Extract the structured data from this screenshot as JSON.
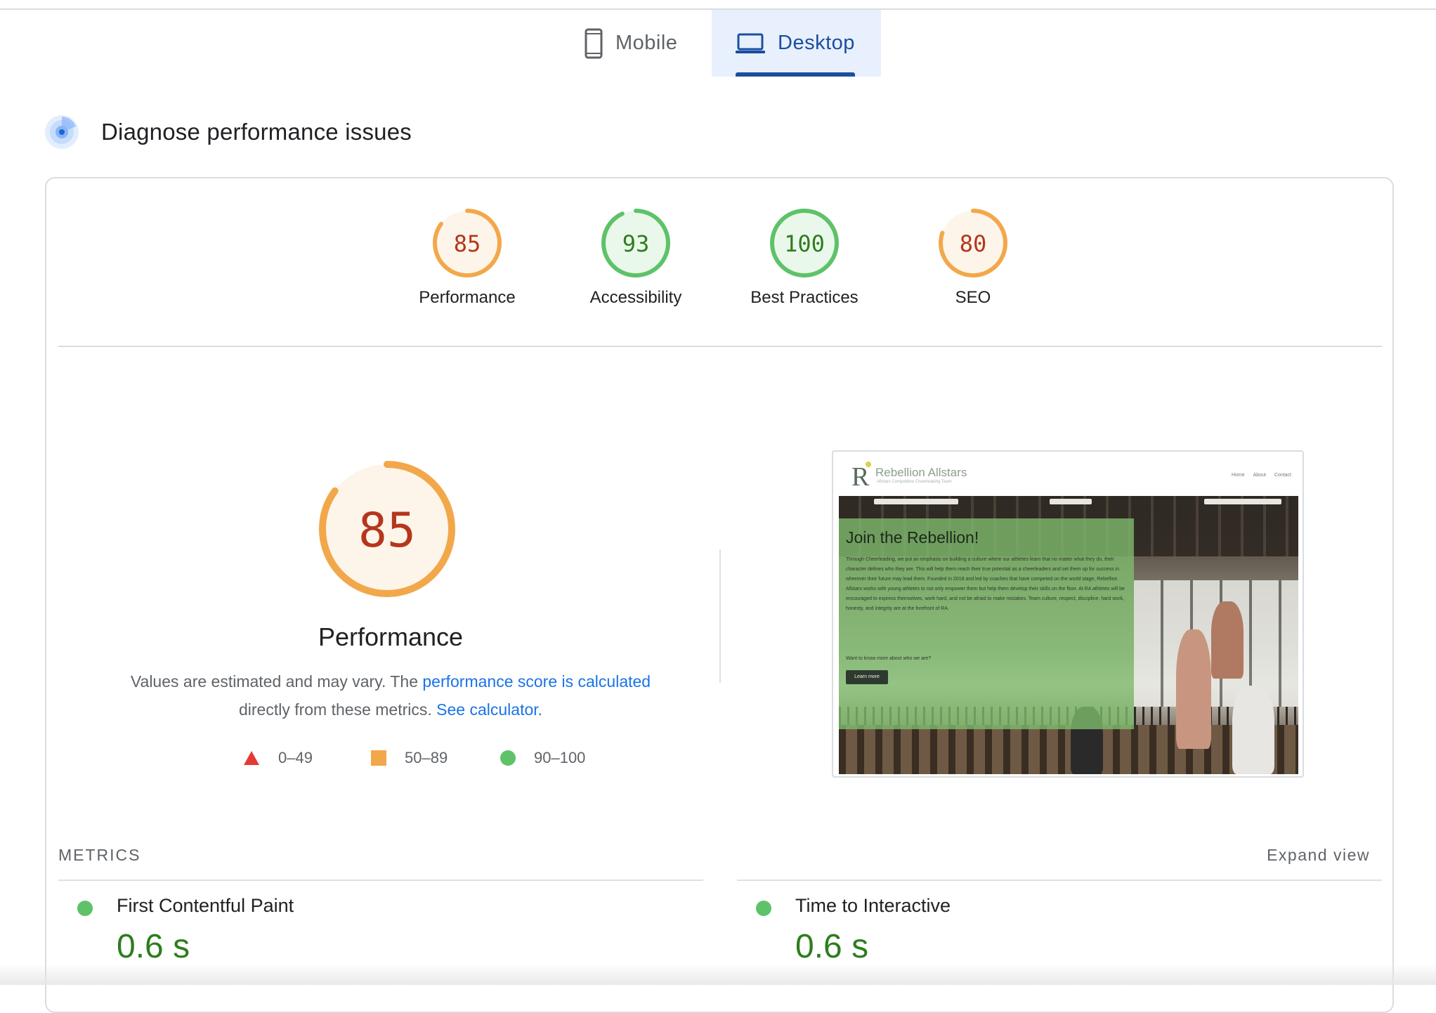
{
  "tabs": [
    {
      "label": "Mobile",
      "icon": "smartphone-icon",
      "selected": false
    },
    {
      "label": "Desktop",
      "icon": "laptop-icon",
      "selected": true
    }
  ],
  "section": {
    "title": "Diagnose performance issues",
    "icon": "radar-icon"
  },
  "scores": [
    {
      "label": "Performance",
      "value": "85",
      "status": "average"
    },
    {
      "label": "Accessibility",
      "value": "93",
      "status": "pass"
    },
    {
      "label": "Best Practices",
      "value": "100",
      "status": "pass"
    },
    {
      "label": "SEO",
      "value": "80",
      "status": "average"
    }
  ],
  "performance": {
    "score": "85",
    "title": "Performance",
    "desc_prefix": "Values are estimated and may vary. The ",
    "desc_link1": "performance score is calculated",
    "desc_middle": " directly from these metrics. ",
    "desc_link2": "See calculator."
  },
  "legend": [
    {
      "range": "0–49",
      "shape": "triangle",
      "color": "#e53935"
    },
    {
      "range": "50–89",
      "shape": "square",
      "color": "#f2a84a"
    },
    {
      "range": "90–100",
      "shape": "circle",
      "color": "#5ec269"
    }
  ],
  "screenshot": {
    "logo_letter": "R",
    "brand": "Rebellion Allstars",
    "tagline": "Allstars Competitive Cheerleading Team",
    "nav": [
      "Home",
      "About",
      "Contact"
    ],
    "heading": "Join the Rebellion!",
    "body": "Through Cheerleading, we put an emphasis on building a culture where our athletes learn that no matter what they do, their character defines who they are. This will help them reach their true potential as a cheerleaders and set them up for success in wherever their future may lead them. Founded in 2018 and led by coaches that have competed on the world stage, Rebellion Allstars works with young athletes to not only empower them but help them develop their skills on the floor. At RA athletes will be encouraged to express themselves, work hard, and not be afraid to make mistakes. Team culture, respect, discipline, hard work, honesty, and integrity are at the forefront of RA.",
    "cta_text": "Want to know more about who we are?",
    "cta_button": "Learn more"
  },
  "metrics": {
    "label": "METRICS",
    "expand": "Expand view",
    "items": [
      {
        "name": "First Contentful Paint",
        "value": "0.6 s",
        "status": "pass"
      },
      {
        "name": "Time to Interactive",
        "value": "0.6 s",
        "status": "pass"
      }
    ]
  },
  "colors": {
    "average_stroke": "#f2a84a",
    "average_fill": "#fef5ea",
    "average_text": "#b5361c",
    "pass_stroke": "#5ec269",
    "pass_fill": "#eaf8ec",
    "pass_text": "#2e7d1e",
    "accent": "#1a4fa0",
    "link": "#1a73e8"
  }
}
